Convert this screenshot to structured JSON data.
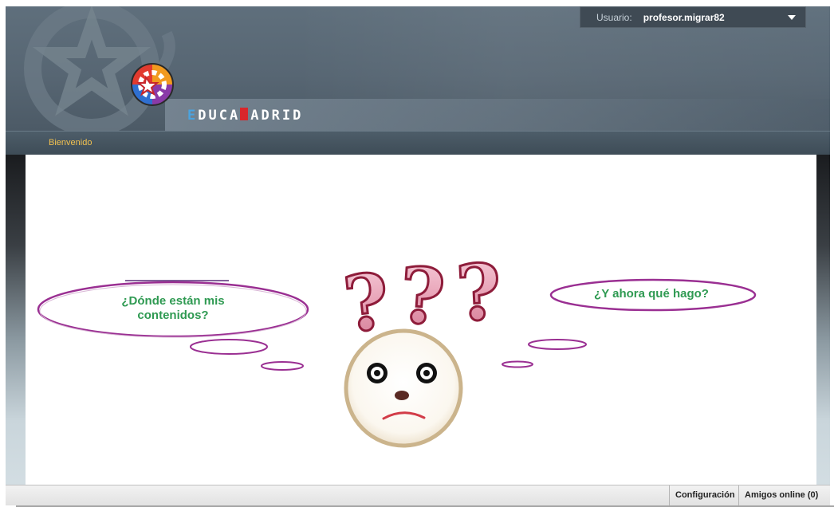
{
  "header": {
    "brand_first": "E",
    "brand_mid": "DUCA",
    "brand_m": "M",
    "brand_rest": "ADRID",
    "user_label": "Usuario:",
    "user_name": "profesor.migrar82"
  },
  "nav": {
    "items": [
      "Bienvenido"
    ]
  },
  "content": {
    "bubble_left": "¿Dónde están mis contenidos?",
    "bubble_left_line1": "¿Dónde están mis",
    "bubble_left_line2": "contenidos?",
    "bubble_right": "¿Y ahora qué hago?",
    "question_marks": "???"
  },
  "statusbar": {
    "config_label": "Configuración",
    "friends_label": "Amigos online (0)"
  },
  "colors": {
    "brand_e": "#4aa3df",
    "brand_m": "#d9262b",
    "bubble_text": "#2f9a52",
    "bubble_outline": "#8e2a8a",
    "nav_link": "#f0c050"
  }
}
